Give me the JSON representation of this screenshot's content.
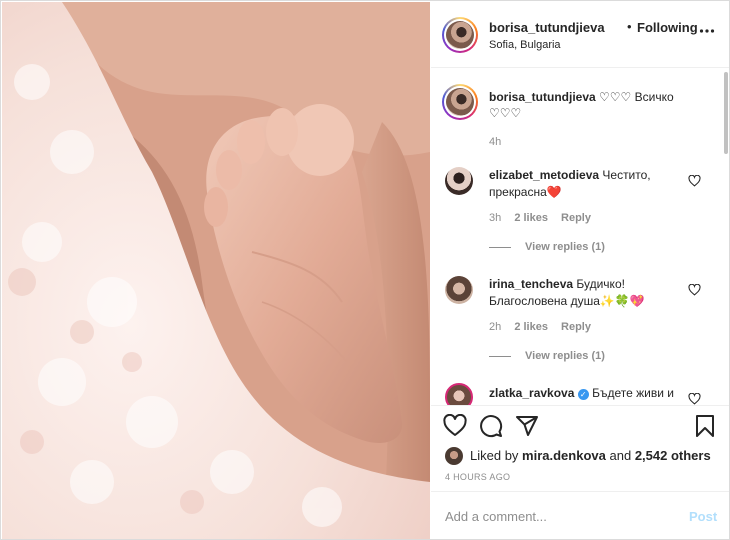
{
  "post": {
    "author": "borisa_tutundjieva",
    "separator": "•",
    "follow_status": "Following",
    "location": "Sofia, Bulgaria",
    "more_icon": "more-horizontal-icon"
  },
  "caption": {
    "username": "borisa_tutundjieva",
    "text": "♡♡♡ Всичко ♡♡♡",
    "time": "4h"
  },
  "comments": [
    {
      "username": "elizabet_metodieva",
      "text": "Честито, прекрасна❤️",
      "time": "3h",
      "likes": "2 likes",
      "reply_label": "Reply",
      "view_replies": "View replies (1)"
    },
    {
      "username": "irina_tencheva",
      "text": "Будичко! Благословена душа✨🍀💖",
      "time": "2h",
      "likes": "2 likes",
      "reply_label": "Reply",
      "view_replies": "View replies (1)"
    },
    {
      "username": "zlatka_ravkova",
      "verified": "✓",
      "text": "Бъдете живи и"
    }
  ],
  "actions": {
    "icons": [
      "heart-icon",
      "comment-icon",
      "share-icon",
      "bookmark-icon"
    ]
  },
  "likes": {
    "prefix": "Liked by",
    "user": "mira.denkova",
    "middle": "and",
    "count": "2,542 others"
  },
  "timestamp": "4 HOURS AGO",
  "add_comment": {
    "placeholder": "Add a comment...",
    "post_label": "Post"
  },
  "colors": {
    "link_disabled": "#b2dffc",
    "secondary_text": "#8e8e8e",
    "primary_text": "#262626",
    "verified_blue": "#3897f0"
  }
}
